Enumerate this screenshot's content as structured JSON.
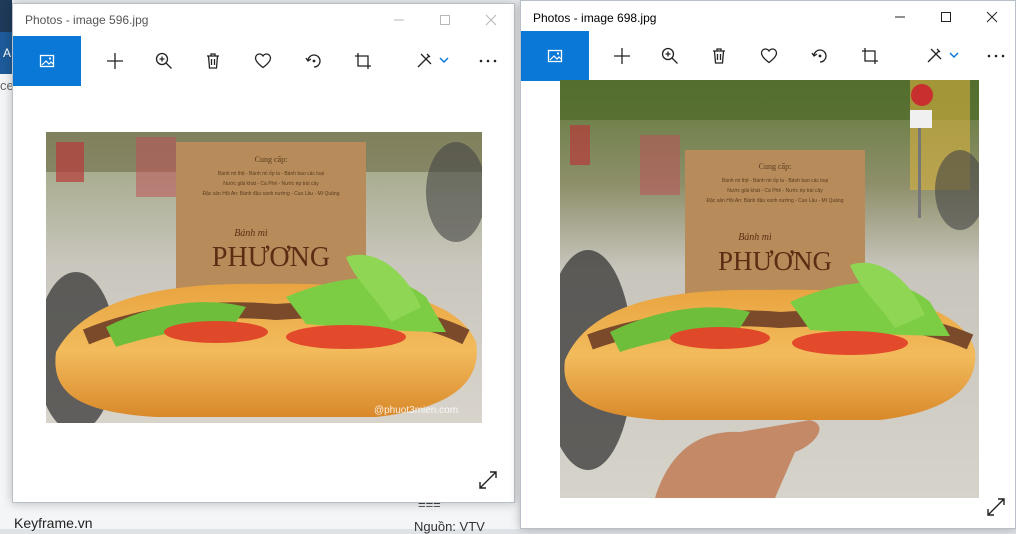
{
  "background": {
    "left_letter": "A",
    "left_fragment": "ce",
    "bottom_text": "Keyframe.vn",
    "mid_equals": "===",
    "mid_text": "Nguồn: VTV"
  },
  "window_left": {
    "title": "Photos - image 596.jpg",
    "state": "inactive",
    "minimize_label": "—",
    "maximize_label": "☐",
    "close_label": "✕",
    "toolbar": [
      "view-image",
      "add",
      "zoom",
      "delete",
      "favorite",
      "rotate",
      "crop",
      "edit",
      "more"
    ],
    "photo": {
      "description_visible_text": [
        "Cung cấp:",
        "Bánh mì Phương",
        "@phuot3mien.com"
      ]
    }
  },
  "window_right": {
    "title": "Photos - image 698.jpg",
    "state": "active",
    "minimize_label": "—",
    "maximize_label": "☐",
    "close_label": "✕",
    "toolbar": [
      "view-image",
      "add",
      "zoom",
      "delete",
      "favorite",
      "rotate",
      "crop",
      "edit",
      "more"
    ],
    "photo": {
      "description_visible_text": [
        "Cung cấp:",
        "Bánh mì Phương"
      ]
    }
  },
  "colors": {
    "accent": "#0a78d7",
    "window_bg": "#ffffff"
  },
  "sign_text": {
    "supply": "Cung cấp:",
    "line1": "Bánh mì thịt - Bánh mì ốp la - Bánh bao các loại",
    "line2": "Nước giải khát - Cà Phê - Nước ép trái cây",
    "line3": "Đặc sản Hội An: Bánh đậu xanh nướng - Cao Lầu - Mì Quảng",
    "brand_small": "Bánh mì",
    "brand_big": "PHƯƠNG",
    "watermark": "@phuot3mien.com"
  }
}
